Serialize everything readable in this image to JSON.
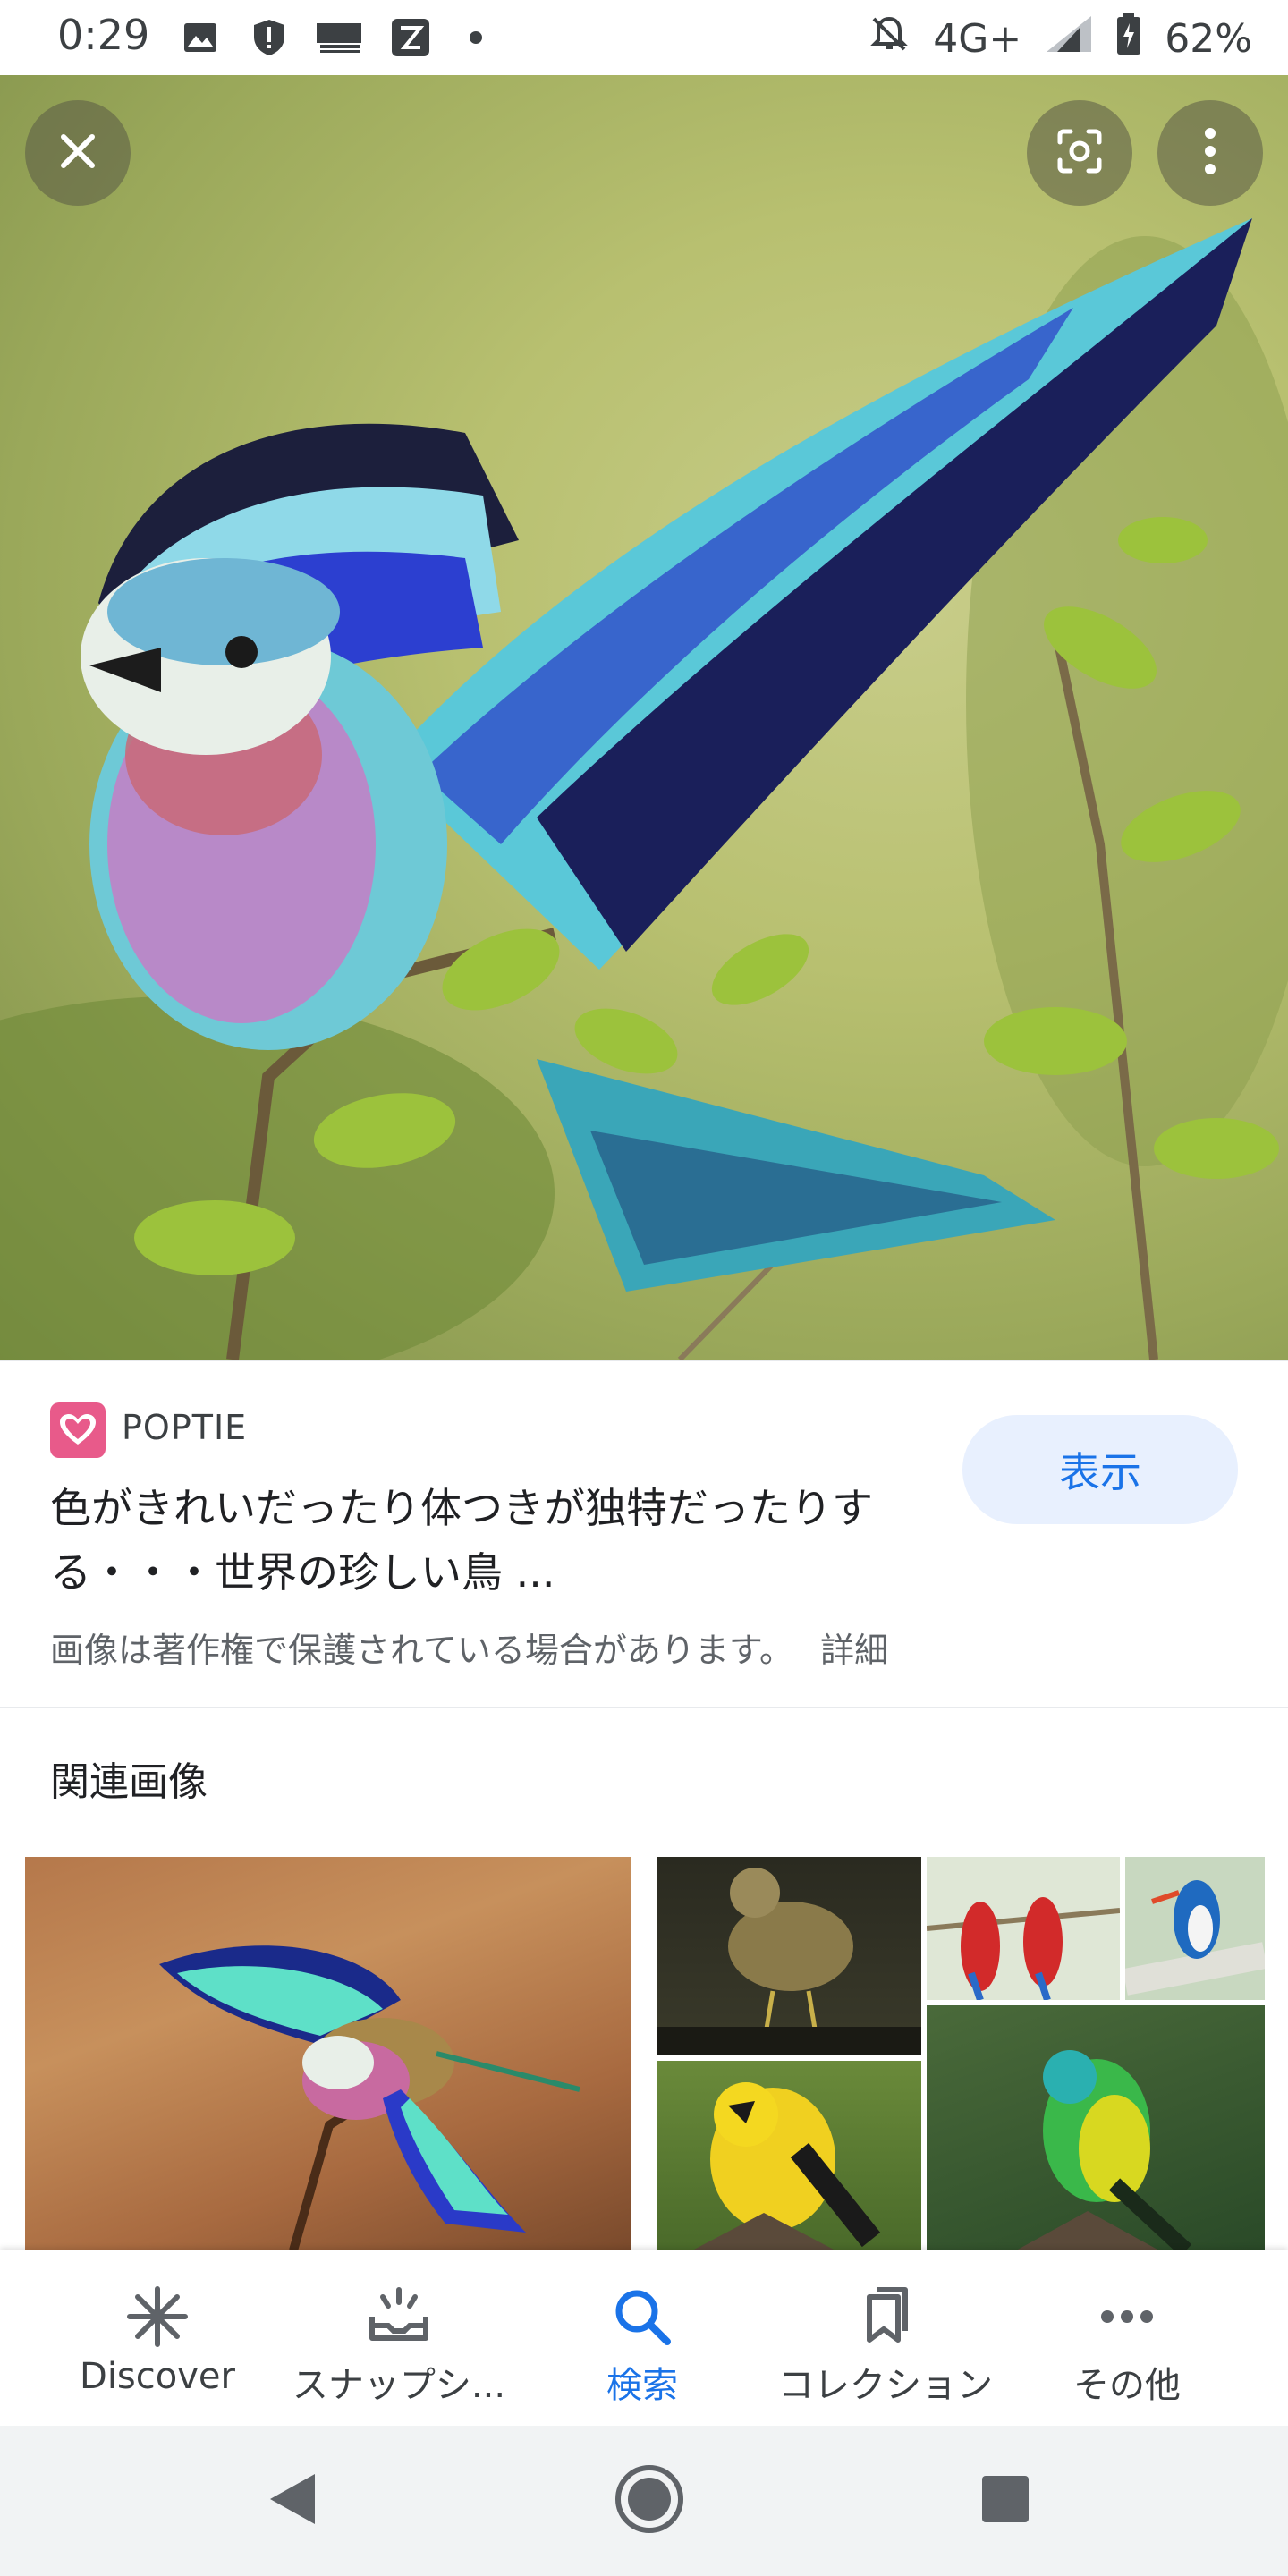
{
  "status_bar": {
    "time": "0:29",
    "network": "4G+",
    "battery": "62%"
  },
  "hero": {
    "close_icon": "close-icon",
    "lens_icon": "lens-icon",
    "more_icon": "more-vert-icon"
  },
  "result": {
    "source_name": "POPTIE",
    "title": "色がきれいだったり体つきが独特だったりする・・・世界の珍しい鳥 ...",
    "view_label": "表示",
    "copyright_text": "画像は著作権で保護されている場合があります。",
    "details_label": "詳細"
  },
  "related": {
    "heading": "関連画像"
  },
  "bottom_nav": {
    "items": [
      {
        "label": "Discover",
        "icon": "asterisk-icon"
      },
      {
        "label": "スナップシ...",
        "icon": "snapshot-icon"
      },
      {
        "label": "検索",
        "icon": "search-icon"
      },
      {
        "label": "コレクション",
        "icon": "collections-icon"
      },
      {
        "label": "その他",
        "icon": "more-horiz-icon"
      }
    ],
    "active_index": 2
  },
  "colors": {
    "accent": "#1a73e8",
    "view_button_bg": "#e8f0fe",
    "source_icon": "#e85a8a"
  }
}
